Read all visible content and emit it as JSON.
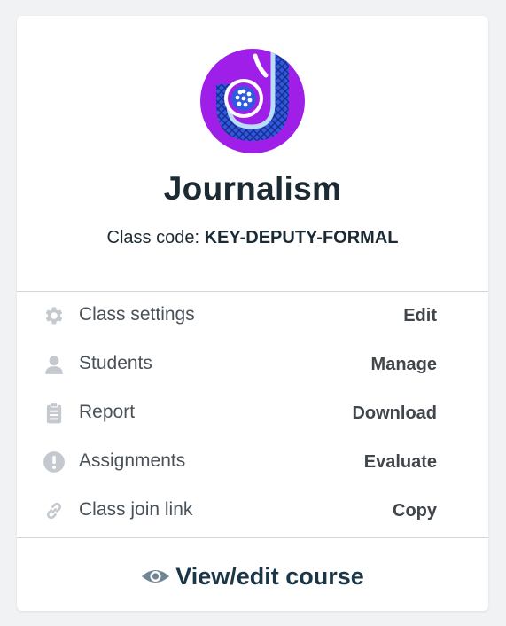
{
  "class": {
    "title": "Journalism",
    "code_label": "Class code: ",
    "code_value": "KEY-DEPUTY-FORMAL"
  },
  "rows": [
    {
      "icon": "gear-icon",
      "label": "Class settings",
      "action": "Edit"
    },
    {
      "icon": "person-icon",
      "label": "Students",
      "action": "Manage"
    },
    {
      "icon": "clipboard-icon",
      "label": "Report",
      "action": "Download"
    },
    {
      "icon": "exclamation-icon",
      "label": "Assignments",
      "action": "Evaluate"
    },
    {
      "icon": "link-icon",
      "label": "Class join link",
      "action": "Copy"
    }
  ],
  "footer": {
    "icon": "eye-icon",
    "label": "View/edit course"
  },
  "colors": {
    "logo_purple": "#a01fe8",
    "logo_blue": "#2f5ae0",
    "logo_light": "#b9dcf8",
    "text_dark": "#1b2a33",
    "icon_gray": "#c3c9cf"
  }
}
